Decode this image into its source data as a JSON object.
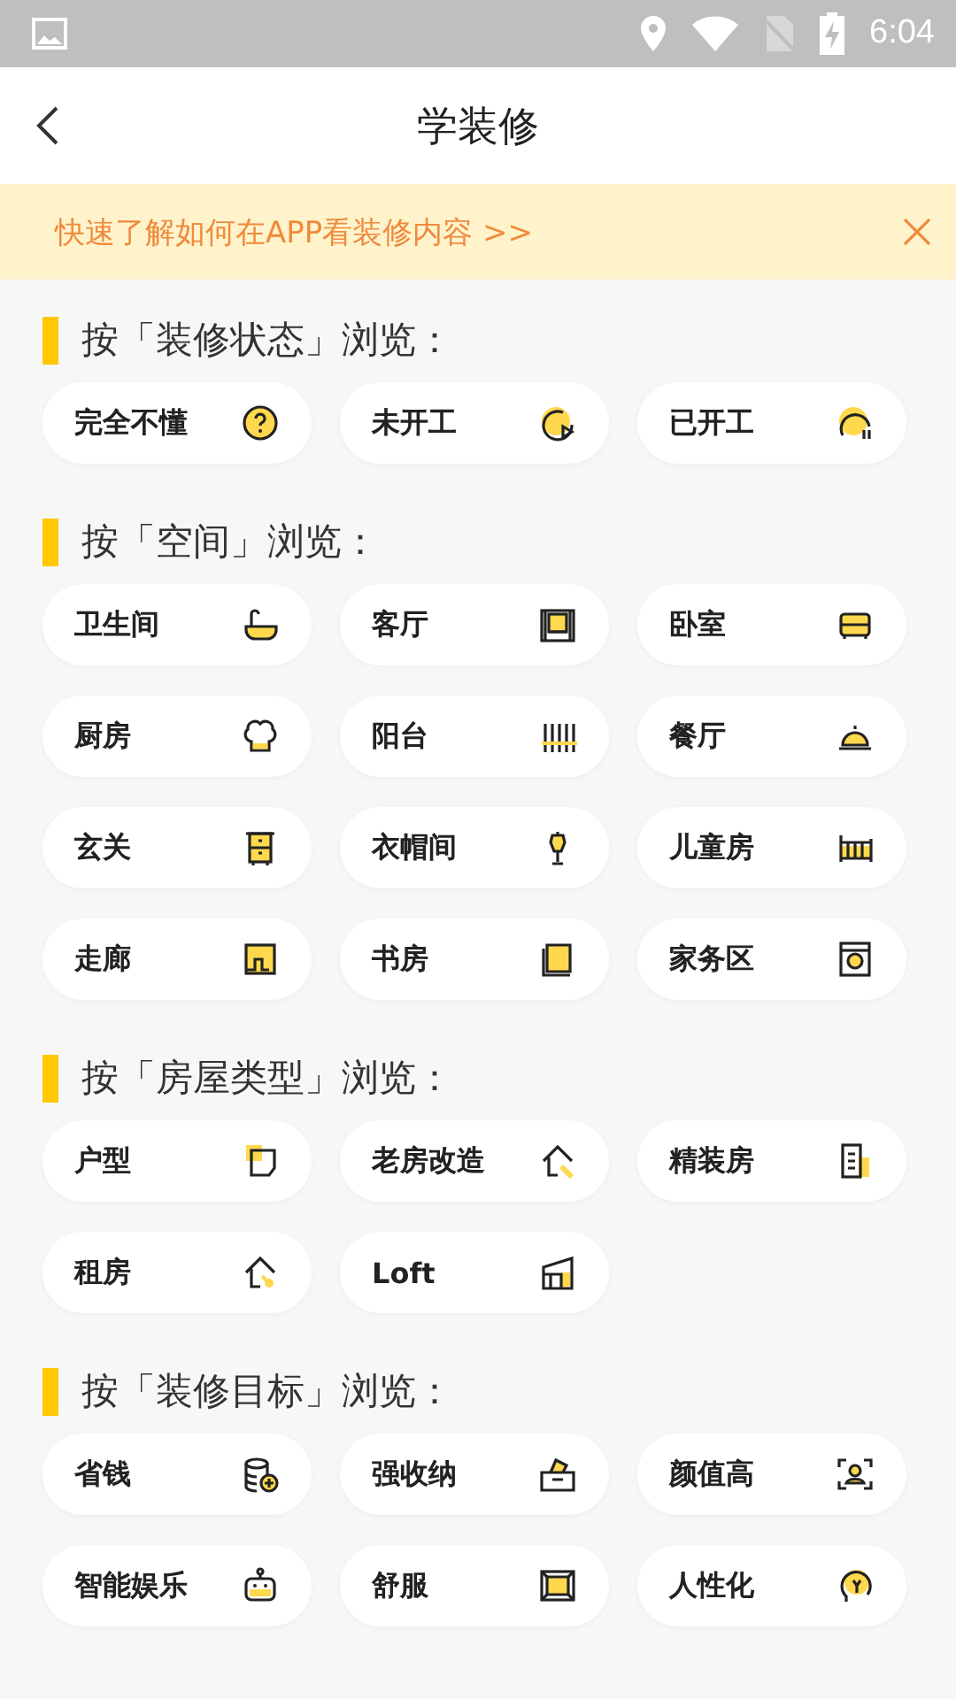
{
  "status_bar": {
    "time": "6:04"
  },
  "header": {
    "title": "学装修"
  },
  "banner": {
    "text": "快速了解如何在APP看装修内容 >>"
  },
  "sections": [
    {
      "title": "按「装修状态」浏览：",
      "chips": [
        {
          "label": "完全不懂"
        },
        {
          "label": "未开工"
        },
        {
          "label": "已开工"
        }
      ]
    },
    {
      "title": "按「空间」浏览：",
      "chips": [
        {
          "label": "卫生间"
        },
        {
          "label": "客厅"
        },
        {
          "label": "卧室"
        },
        {
          "label": "厨房"
        },
        {
          "label": "阳台"
        },
        {
          "label": "餐厅"
        },
        {
          "label": "玄关"
        },
        {
          "label": "衣帽间"
        },
        {
          "label": "儿童房"
        },
        {
          "label": "走廊"
        },
        {
          "label": "书房"
        },
        {
          "label": "家务区"
        }
      ]
    },
    {
      "title": "按「房屋类型」浏览：",
      "chips": [
        {
          "label": "户型"
        },
        {
          "label": "老房改造"
        },
        {
          "label": "精装房"
        },
        {
          "label": "租房"
        },
        {
          "label": "Loft"
        }
      ]
    },
    {
      "title": "按「装修目标」浏览：",
      "chips": [
        {
          "label": "省钱"
        },
        {
          "label": "强收纳"
        },
        {
          "label": "颜值高"
        },
        {
          "label": "智能娱乐"
        },
        {
          "label": "舒服"
        },
        {
          "label": "人性化"
        }
      ]
    }
  ]
}
